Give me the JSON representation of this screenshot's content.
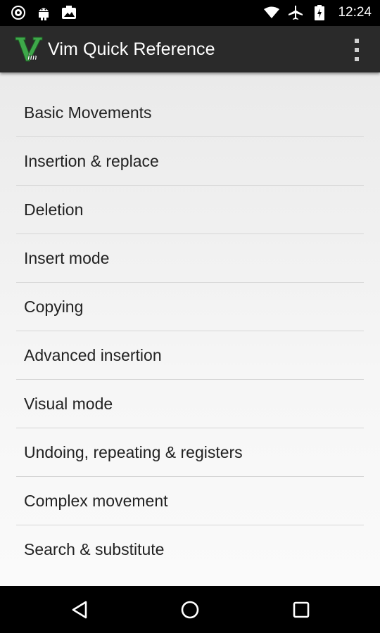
{
  "status_bar": {
    "time": "12:24",
    "left_icons": [
      "record-icon",
      "android-icon",
      "photo-icon"
    ],
    "right_icons": [
      "wifi-icon",
      "airplane-icon",
      "battery-icon"
    ]
  },
  "action_bar": {
    "title": "Vim Quick Reference",
    "logo": "vim-logo-icon",
    "overflow": "overflow-menu-icon"
  },
  "menu": {
    "items": [
      {
        "label": "Basic Movements"
      },
      {
        "label": "Insertion & replace"
      },
      {
        "label": "Deletion"
      },
      {
        "label": "Insert mode"
      },
      {
        "label": "Copying"
      },
      {
        "label": "Advanced insertion"
      },
      {
        "label": "Visual mode"
      },
      {
        "label": "Undoing, repeating & registers"
      },
      {
        "label": "Complex movement"
      },
      {
        "label": "Search & substitute"
      }
    ]
  },
  "nav_bar": {
    "buttons": [
      "back-icon",
      "home-icon",
      "recents-icon"
    ]
  },
  "colors": {
    "action_bar": "#2a2a2a",
    "vim_green": "#3ea84a",
    "text": "#222222",
    "divider": "#d6d6d6"
  }
}
